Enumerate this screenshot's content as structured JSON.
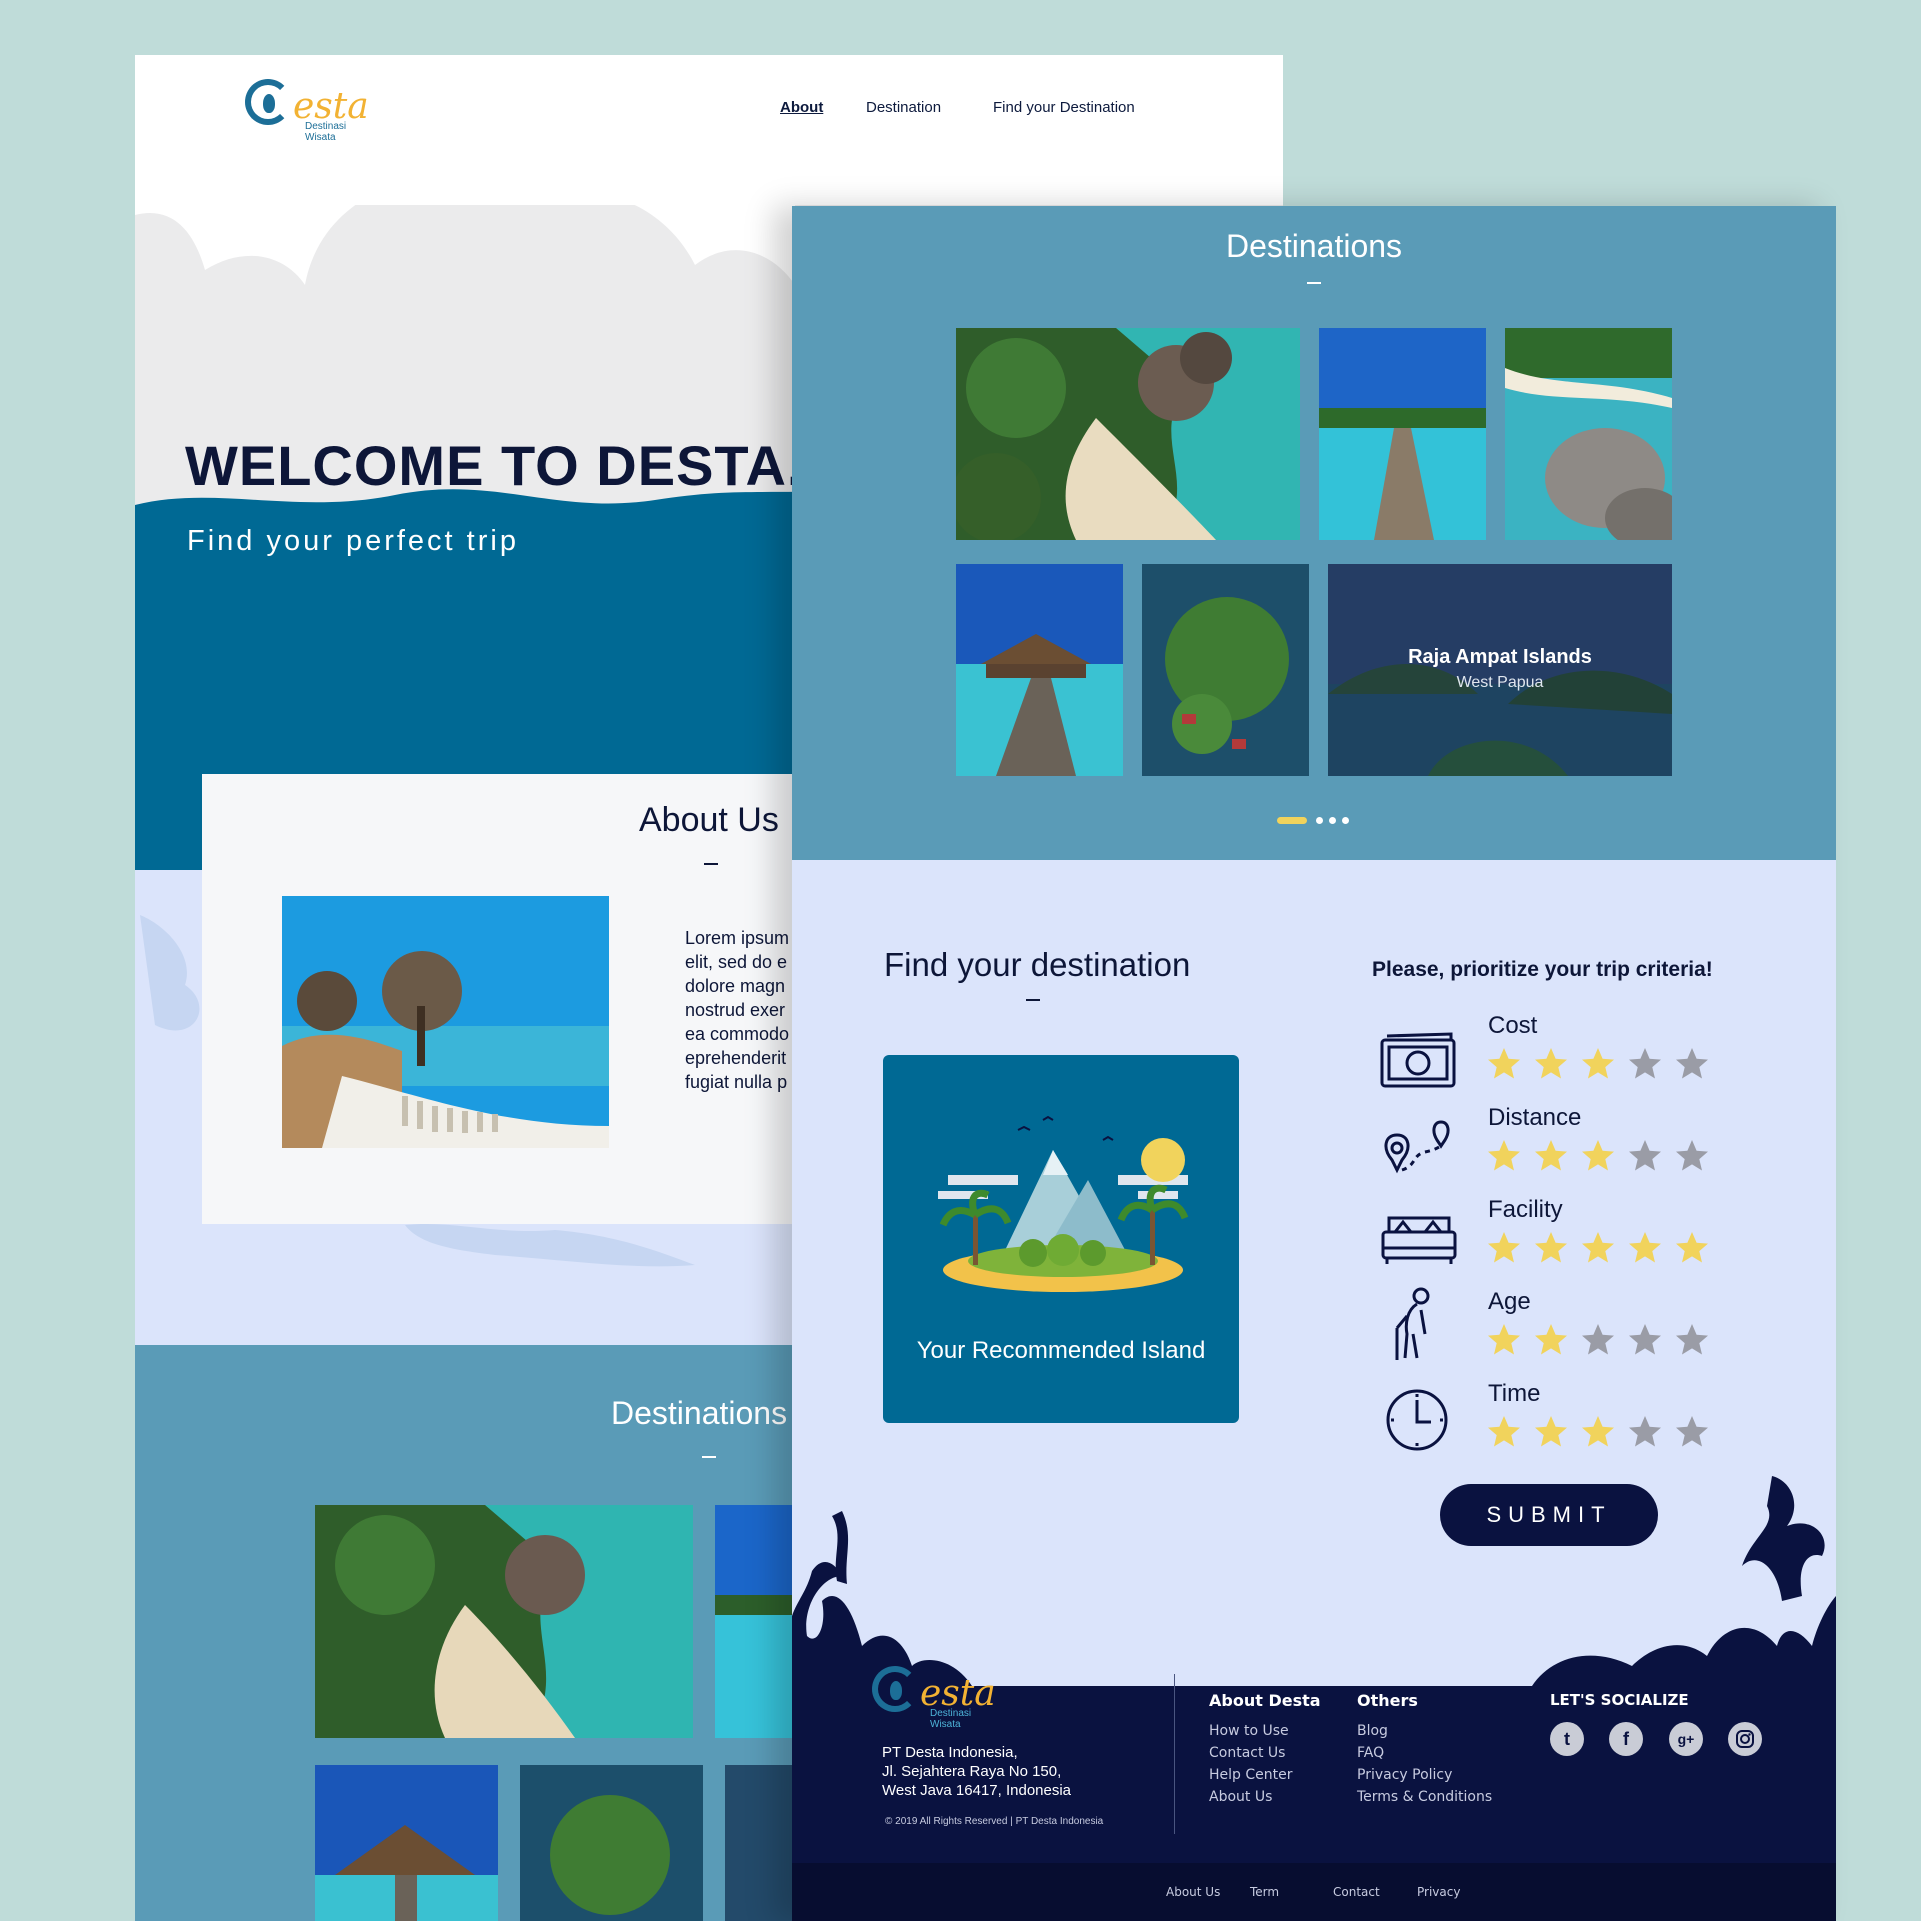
{
  "brand": {
    "name": "esta",
    "tagline": "Destinasi Wisata"
  },
  "nav": {
    "about": "About",
    "destination": "Destination",
    "find": "Find your Destination"
  },
  "hero": {
    "title": "WELCOME TO DESTA.",
    "subtitle": "Find your perfect trip"
  },
  "about": {
    "title": "About Us",
    "lines": [
      "Lorem ipsum",
      "elit, sed do e",
      "dolore magn",
      "nostrud exer",
      "ea commodo",
      "eprehenderit",
      "fugiat nulla p"
    ]
  },
  "back_destinations": {
    "title": "Destinations"
  },
  "destinations": {
    "title": "Destinations",
    "featured": {
      "name": "Raja Ampat Islands",
      "region": "West Papua"
    },
    "carousel": {
      "pages": 4,
      "active": 1
    }
  },
  "finder": {
    "title": "Find your destination",
    "card_label": "Your Recommended Island",
    "criteria_title": "Please, prioritize your trip criteria!",
    "criteria": [
      {
        "label": "Cost",
        "icon": "money-icon",
        "rating": 3
      },
      {
        "label": "Distance",
        "icon": "route-pin-icon",
        "rating": 3
      },
      {
        "label": "Facility",
        "icon": "bed-icon",
        "rating": 5
      },
      {
        "label": "Age",
        "icon": "elderly-person-icon",
        "rating": 2
      },
      {
        "label": "Time",
        "icon": "clock-icon",
        "rating": 3
      }
    ],
    "max_rating": 5,
    "submit": "SUBMIT"
  },
  "footer": {
    "address": [
      "PT Desta Indonesia,",
      "Jl. Sejahtera Raya No 150,",
      "West Java 16417, Indonesia"
    ],
    "copyright": "© 2019 All Rights Reserved | PT Desta Indonesia",
    "about_head": "About Desta",
    "about_links": [
      "How to Use",
      "Contact Us",
      "Help Center",
      "About Us"
    ],
    "others_head": "Others",
    "others_links": [
      "Blog",
      "FAQ",
      "Privacy Policy",
      "Terms & Conditions"
    ],
    "social_head": "LET'S SOCIALIZE",
    "social": [
      "twitter-icon",
      "facebook-icon",
      "google-plus-icon",
      "instagram-icon"
    ],
    "bottom_links": [
      "About Us",
      "Term",
      "Contact",
      "Privacy"
    ]
  },
  "colors": {
    "navy": "#0a1240",
    "teal": "#5a9bb7",
    "deep_blue": "#006994",
    "lavender": "#dbe4fb",
    "star_on": "#f1d35c",
    "star_off": "#9a9ca6"
  }
}
